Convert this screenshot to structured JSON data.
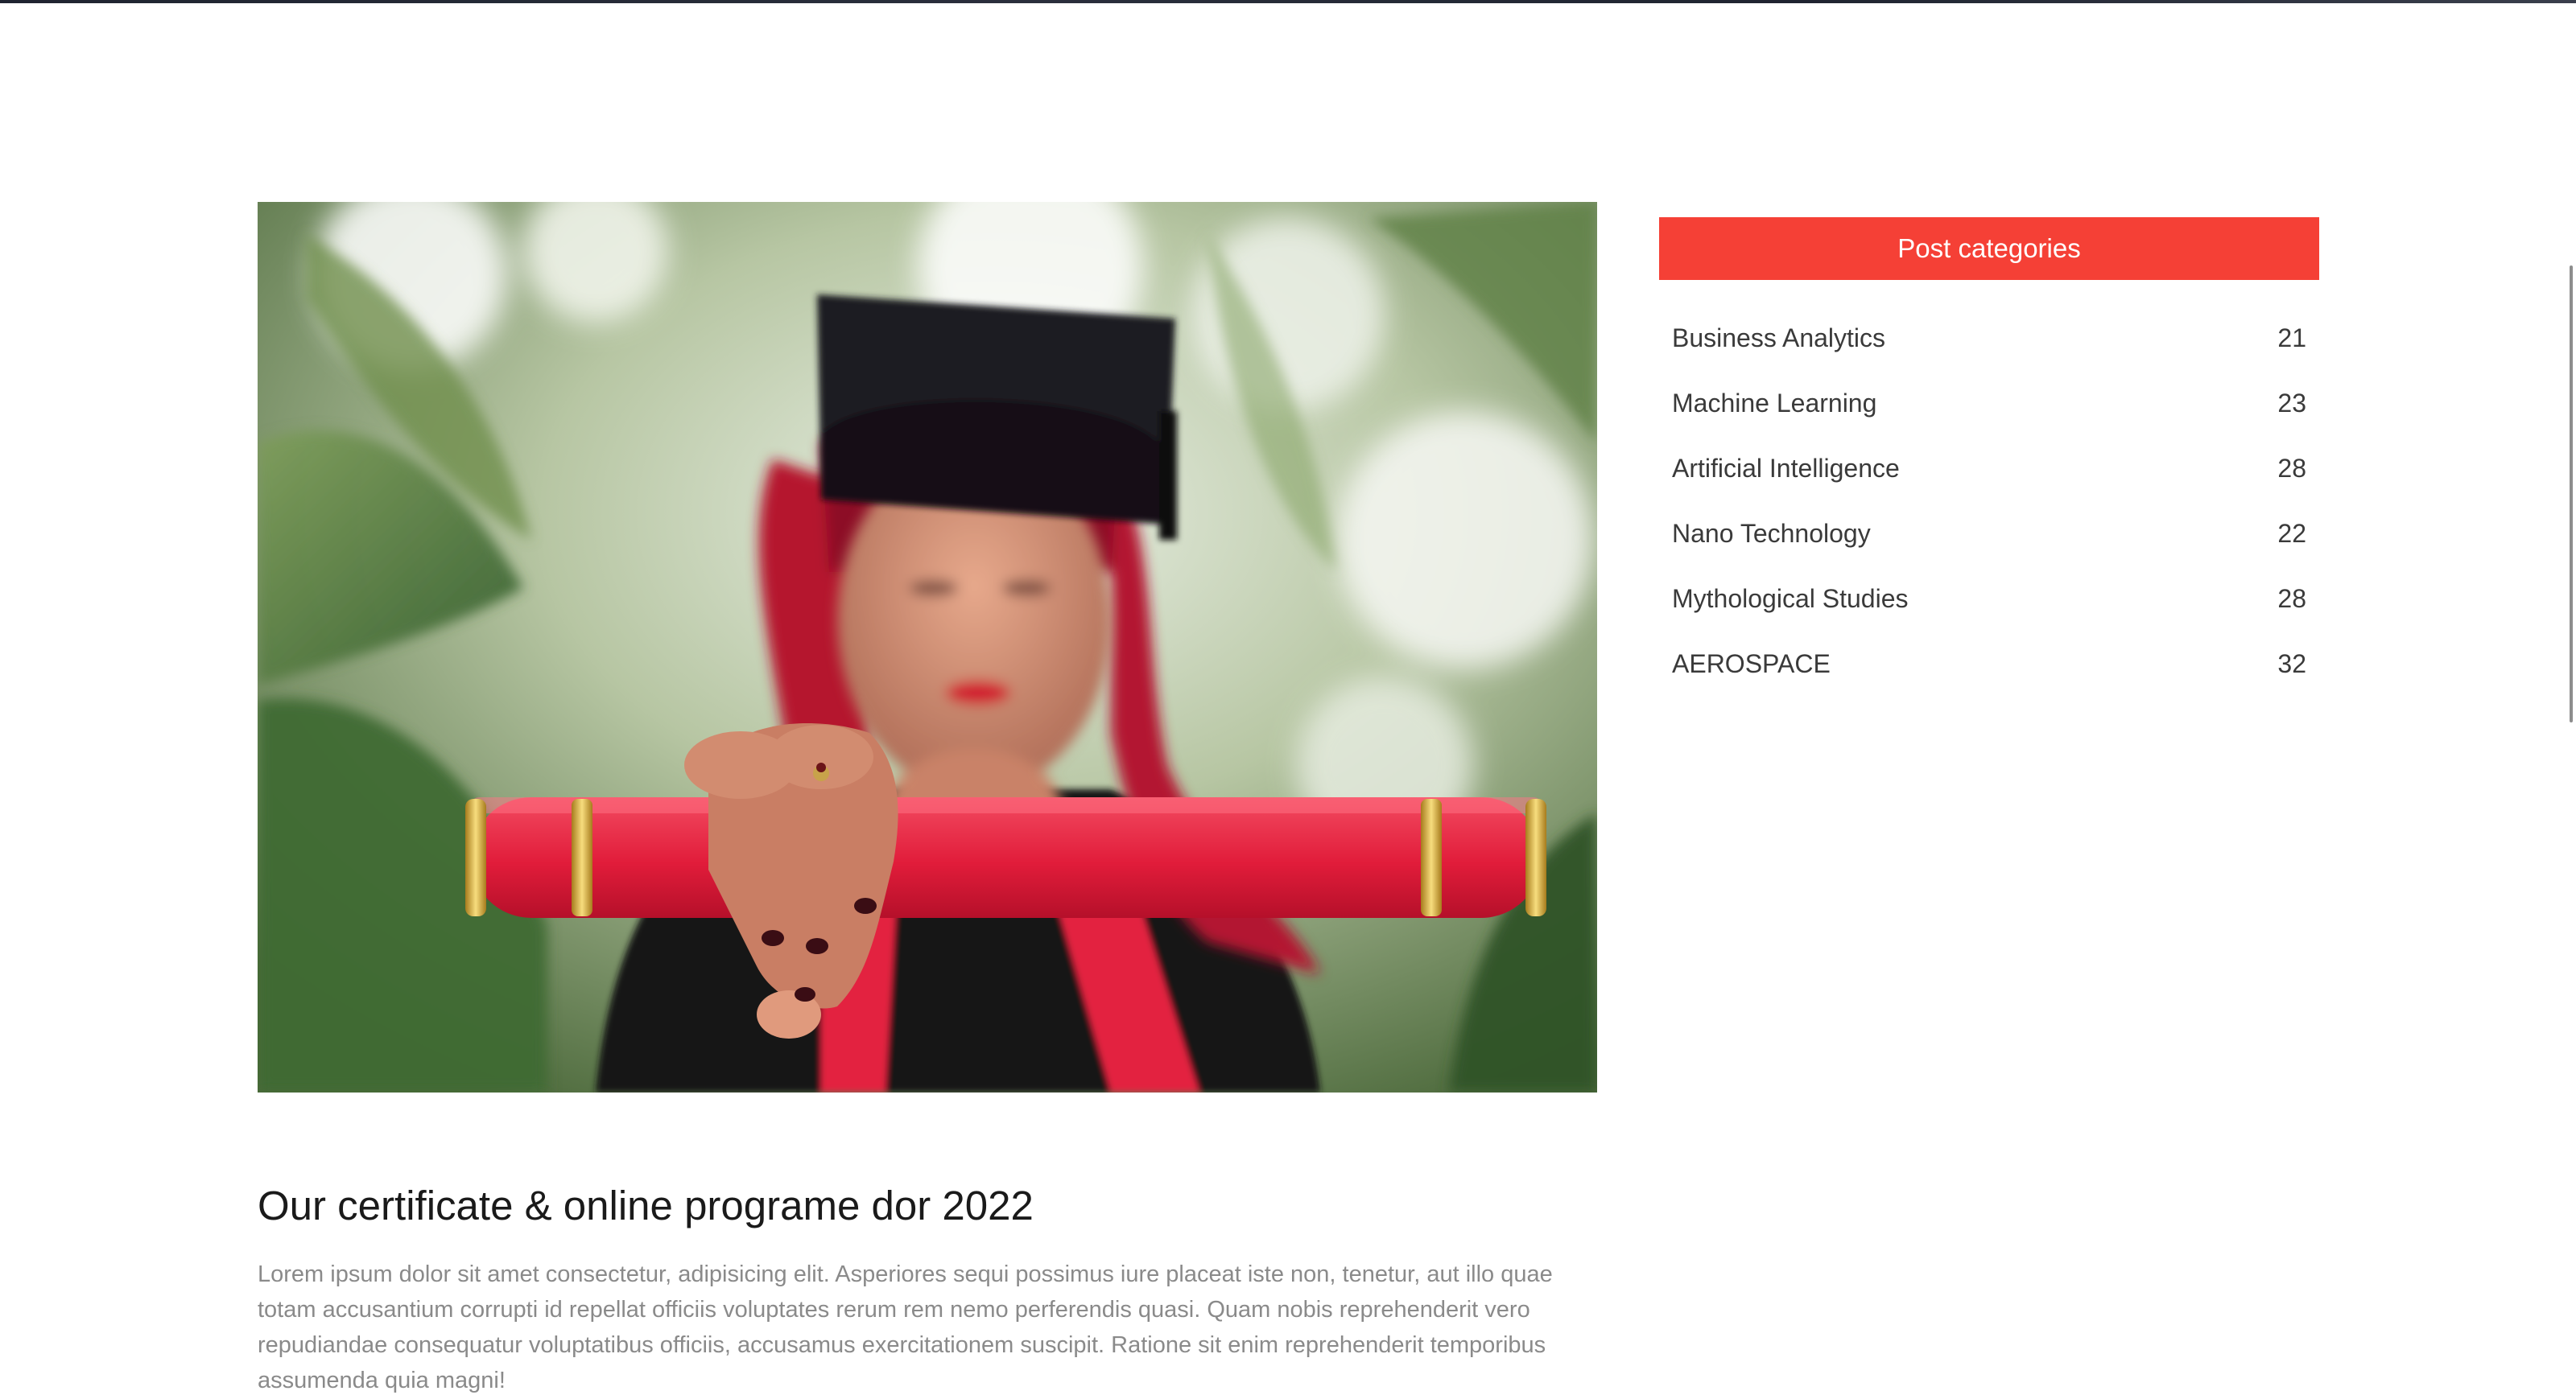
{
  "hero": {
    "alt": "Graduate holding a red diploma scroll"
  },
  "post": {
    "title": "Our certificate & online programe dor 2022",
    "body": "Lorem ipsum dolor sit amet consectetur, adipisicing elit. Asperiores sequi possimus iure placeat iste non, tenetur, aut illo quae totam accusantium corrupti id repellat officiis voluptates rerum rem nemo perferendis quasi. Quam nobis reprehenderit vero repudiandae consequatur voluptatibus officiis, accusamus exercitationem suscipit. Ratione sit enim reprehenderit temporibus assumenda quia magni!"
  },
  "sidebar": {
    "header": "Post categories",
    "items": [
      {
        "label": "Business Analytics",
        "count": "21"
      },
      {
        "label": "Machine Learning",
        "count": "23"
      },
      {
        "label": "Artificial Intelligence",
        "count": "28"
      },
      {
        "label": "Nano Technology",
        "count": "22"
      },
      {
        "label": "Mythological Studies",
        "count": "28"
      },
      {
        "label": "AEROSPACE",
        "count": "32"
      }
    ]
  },
  "colors": {
    "accent": "#f54036",
    "title_text": "#1a1a1a",
    "body_text": "#8a8a8a",
    "category_text": "#3a3a3a"
  }
}
